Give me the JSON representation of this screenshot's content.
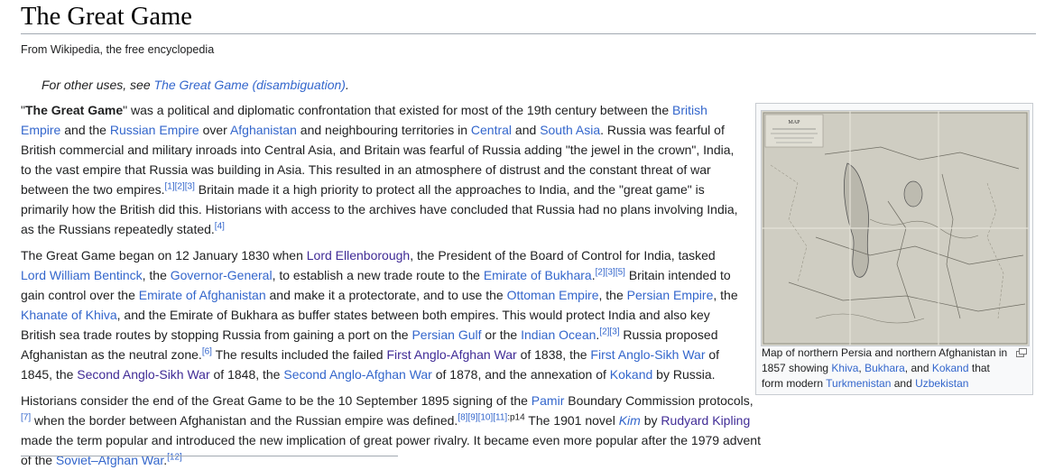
{
  "article": {
    "title": "The Great Game",
    "tagline": "From Wikipedia, the free encyclopedia",
    "hatnote": {
      "prefix": "For other uses, see ",
      "link": "The Great Game (disambiguation)",
      "suffix": "."
    }
  },
  "paragraphs": [
    [
      {
        "t": "\""
      },
      {
        "t": "The Great Game",
        "b": true
      },
      {
        "t": "\" was a political and diplomatic confrontation that existed for most of the 19th century between the "
      },
      {
        "t": "British Empire",
        "l": true
      },
      {
        "t": " and the "
      },
      {
        "t": "Russian Empire",
        "l": true
      },
      {
        "t": " over "
      },
      {
        "t": "Afghanistan",
        "l": true
      },
      {
        "t": " and neighbouring territories in "
      },
      {
        "t": "Central",
        "l": true
      },
      {
        "t": " and "
      },
      {
        "t": "South Asia",
        "l": true
      },
      {
        "t": ". Russia was fearful of British commercial and military inroads into Central Asia, and Britain was fearful of Russia adding \"the jewel in the crown\", India, to the vast empire that Russia was building in Asia. This resulted in an atmosphere of distrust and the constant threat of war between the two empires."
      },
      {
        "t": "[1]",
        "s": true
      },
      {
        "t": "[2]",
        "s": true
      },
      {
        "t": "[3]",
        "s": true
      },
      {
        "t": " Britain made it a high priority to protect all the approaches to India, and the \"great game\" is primarily how the British did this. Historians with access to the archives have concluded that Russia had no plans involving India, as the Russians repeatedly stated."
      },
      {
        "t": "[4]",
        "s": true
      }
    ],
    [
      {
        "t": "The Great Game began on 12 January 1830 when "
      },
      {
        "t": "Lord Ellenborough",
        "l": true,
        "v": true
      },
      {
        "t": ", the President of the Board of Control for India, tasked "
      },
      {
        "t": "Lord William Bentinck",
        "l": true
      },
      {
        "t": ", the "
      },
      {
        "t": "Governor-General",
        "l": true
      },
      {
        "t": ", to establish a new trade route to the "
      },
      {
        "t": "Emirate of Bukhara",
        "l": true
      },
      {
        "t": ".",
        "x": true
      },
      {
        "t": "[2]",
        "s": true
      },
      {
        "t": "[3]",
        "s": true
      },
      {
        "t": "[5]",
        "s": true
      },
      {
        "t": " Britain intended to gain control over the "
      },
      {
        "t": "Emirate of Afghanistan",
        "l": true
      },
      {
        "t": " and make it a protectorate, and to use the "
      },
      {
        "t": "Ottoman Empire",
        "l": true
      },
      {
        "t": ", the "
      },
      {
        "t": "Persian Empire",
        "l": true
      },
      {
        "t": ", the "
      },
      {
        "t": "Khanate of Khiva",
        "l": true
      },
      {
        "t": ", and the Emirate of Bukhara as buffer states between both empires. This would protect India and also key British sea trade routes by stopping Russia from gaining a port on the "
      },
      {
        "t": "Persian Gulf",
        "l": true
      },
      {
        "t": " or the "
      },
      {
        "t": "Indian Ocean",
        "l": true
      },
      {
        "t": "."
      },
      {
        "t": "[2]",
        "s": true
      },
      {
        "t": "[3]",
        "s": true
      },
      {
        "t": " Russia proposed Afghanistan as the neutral zone."
      },
      {
        "t": "[6]",
        "s": true
      },
      {
        "t": " The results included the failed "
      },
      {
        "t": "First Anglo-Afghan War",
        "l": true,
        "v": true
      },
      {
        "t": " of 1838, the "
      },
      {
        "t": "First Anglo-Sikh War",
        "l": true
      },
      {
        "t": " of 1845, the "
      },
      {
        "t": "Second Anglo-Sikh War",
        "l": true,
        "v": true
      },
      {
        "t": " of 1848, the "
      },
      {
        "t": "Second Anglo-Afghan War",
        "l": true
      },
      {
        "t": " of 1878, and the annexation of "
      },
      {
        "t": "Kokand",
        "l": true
      },
      {
        "t": " by Russia."
      }
    ],
    [
      {
        "t": "Historians consider the end of the Great Game to be the 10 September 1895 signing of the "
      },
      {
        "t": "Pamir",
        "l": true
      },
      {
        "t": " Boundary Commission protocols,"
      },
      {
        "t": "[7]",
        "s": true
      },
      {
        "t": " when the border between Afghanistan and the Russian empire was defined."
      },
      {
        "t": "[8]",
        "s": true
      },
      {
        "t": "[9]",
        "s": true
      },
      {
        "t": "[10]",
        "s": true
      },
      {
        "t": "[11]",
        "s": true
      },
      {
        "t": ":p14",
        "s": true,
        "plain": true
      },
      {
        "t": " The 1901 novel "
      },
      {
        "t": "Kim",
        "l": true,
        "i": true
      },
      {
        "t": " by "
      },
      {
        "t": "Rudyard Kipling",
        "l": true,
        "v": true
      },
      {
        "t": " made the term popular and introduced the new implication of great power rivalry. It became even more popular after the 1979 advent of the "
      },
      {
        "t": "Soviet–Afghan War",
        "l": true
      },
      {
        "t": "."
      },
      {
        "t": "[12]",
        "s": true
      }
    ]
  ],
  "figure": {
    "caption": [
      {
        "t": "Map of northern Persia and northern Afghanistan in 1857 showing "
      },
      {
        "t": "Khiva",
        "l": true
      },
      {
        "t": ", "
      },
      {
        "t": "Bukhara",
        "l": true
      },
      {
        "t": ", and "
      },
      {
        "t": "Kokand",
        "l": true
      },
      {
        "t": " that form modern "
      },
      {
        "t": "Turkmenistan",
        "l": true
      },
      {
        "t": " and "
      },
      {
        "t": "Uzbekistan",
        "l": true
      }
    ],
    "map_title": "MAP",
    "magnify_icon": "magnify-icon"
  }
}
